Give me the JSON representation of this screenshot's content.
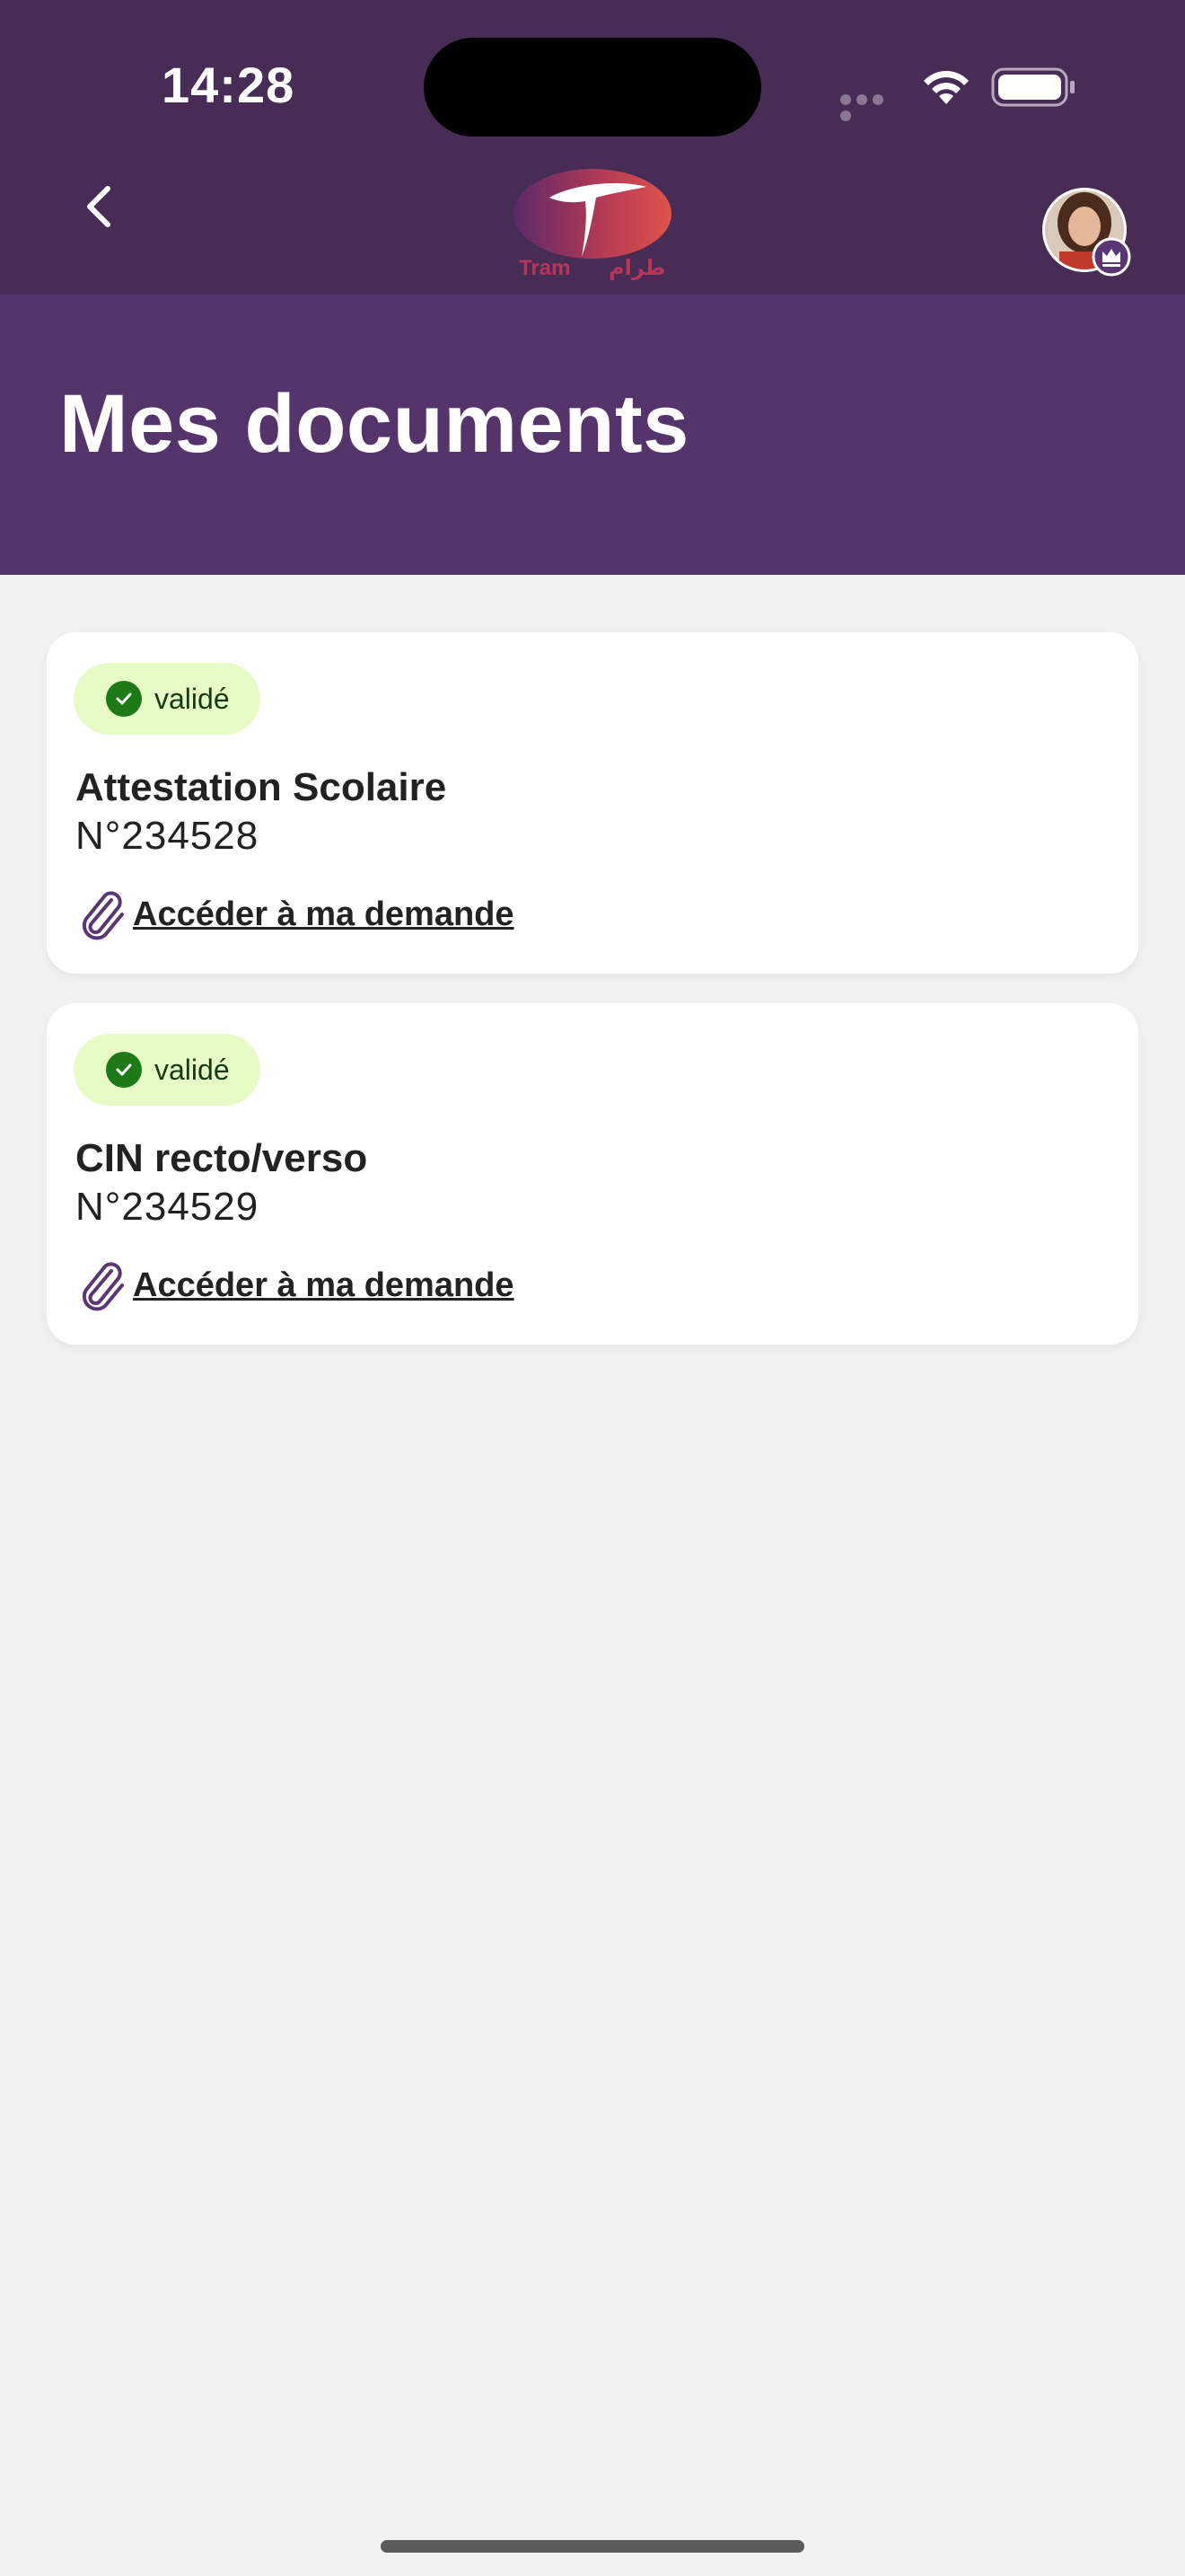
{
  "status_bar": {
    "time": "14:28"
  },
  "header": {
    "logo_text_latin": "Tram",
    "logo_text_arabic": "طرام",
    "title": "Mes documents"
  },
  "documents": [
    {
      "status": "validé",
      "title": "Attestation Scolaire",
      "number": "N°234528",
      "link_label": "Accéder à ma demande"
    },
    {
      "status": "validé",
      "title": "CIN recto/verso",
      "number": "N°234529",
      "link_label": "Accéder à ma demande"
    }
  ],
  "icons": {
    "back": "chevron-left-icon",
    "wifi": "wifi-icon",
    "battery": "battery-icon",
    "check": "check-icon",
    "attachment": "paperclip-icon",
    "avatar_badge": "crown-icon"
  },
  "colors": {
    "header_dark": "#472d55",
    "header_title_band": "#55346b",
    "background": "#f1f1f1",
    "badge_bg": "#e6fbc6",
    "badge_check": "#1e7a16",
    "paperclip": "#5a3672"
  }
}
